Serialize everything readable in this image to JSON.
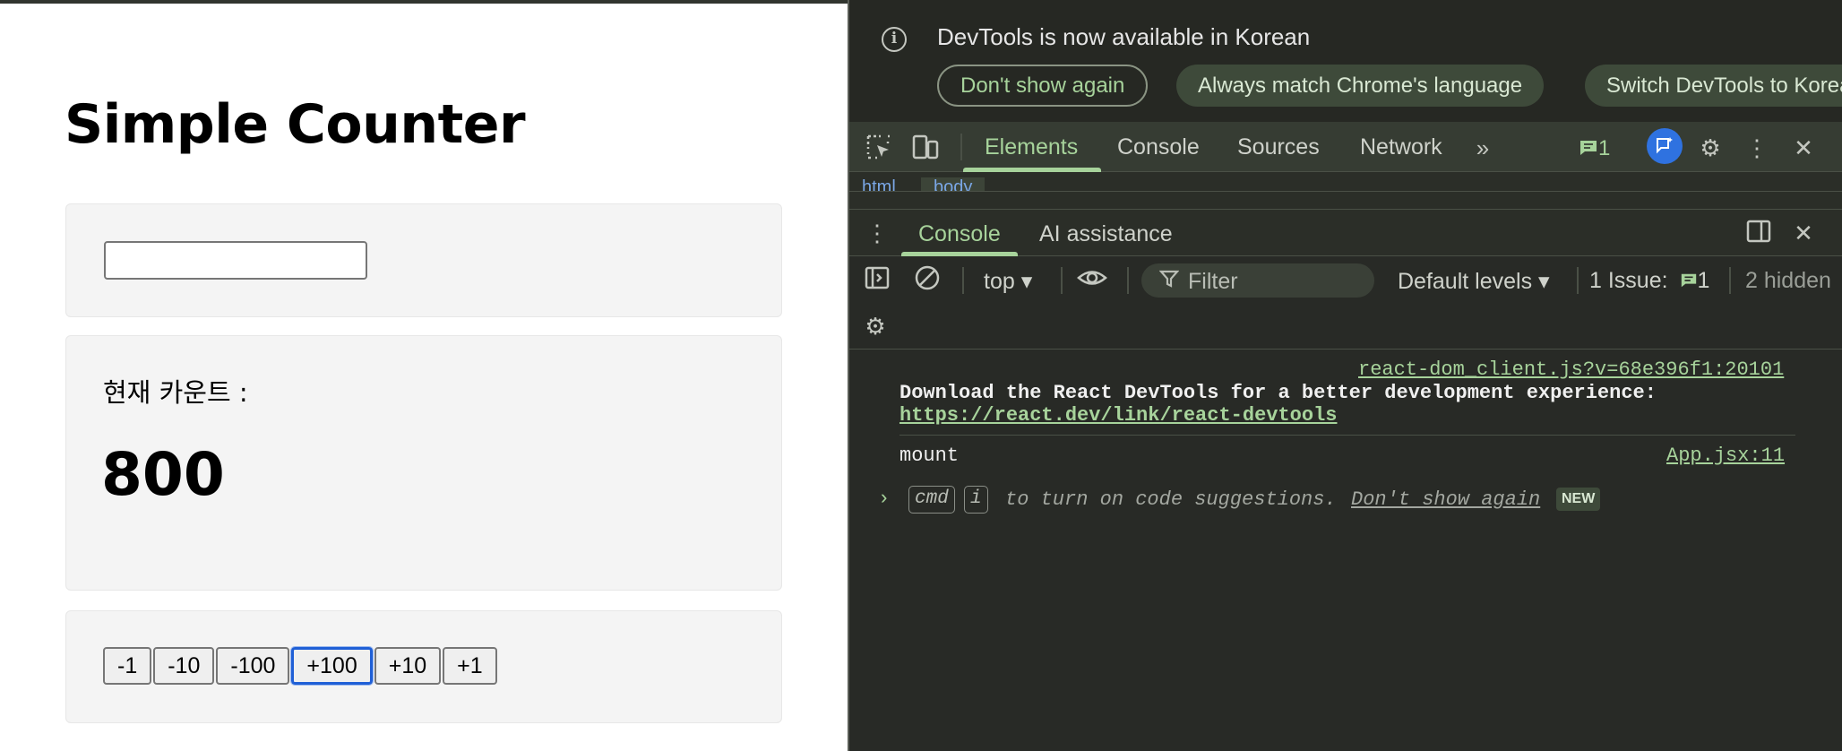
{
  "app": {
    "title": "Simple Counter",
    "input_value": "",
    "count_label": "현재 카운트 :",
    "count_value": "800",
    "buttons": [
      "-1",
      "-10",
      "-100",
      "+100",
      "+10",
      "+1"
    ],
    "focused_button": "+100"
  },
  "devtools": {
    "infobar": {
      "message": "DevTools is now available in Korean",
      "dont_show": "Don't show again",
      "match_language": "Always match Chrome's language",
      "switch": "Switch DevTools to Korean"
    },
    "tabs": [
      "Elements",
      "Console",
      "Sources",
      "Network"
    ],
    "active_tab": "Elements",
    "issues_count": "1",
    "breadcrumbs": [
      "html",
      "body"
    ],
    "drawer_tabs": [
      "Console",
      "AI assistance"
    ],
    "active_drawer_tab": "Console",
    "console_toolbar": {
      "context": "top",
      "filter_placeholder": "Filter",
      "levels": "Default levels",
      "issues_label": "1 Issue:",
      "issues_count": "1",
      "hidden": "2 hidden"
    },
    "messages": [
      {
        "source": "react-dom_client.js?v=68e396f1:20101",
        "text": "Download the React DevTools for a better development experience:",
        "link": "https://react.dev/link/react-devtools"
      },
      {
        "source": "App.jsx:11",
        "text": "mount"
      }
    ],
    "prompt": {
      "key1": "cmd",
      "key2": "i",
      "hint": "to turn on code suggestions.",
      "dont_show": "Don't show again",
      "badge": "NEW"
    }
  },
  "colors": {
    "accent_green": "#a7d39b",
    "focus_blue": "#1f5fd6",
    "devtools_bg": "#282a26"
  }
}
